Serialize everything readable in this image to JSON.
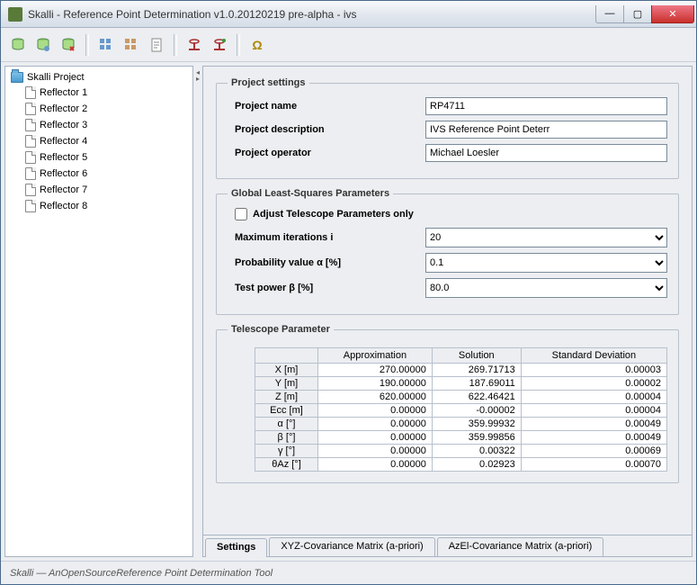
{
  "window": {
    "title": "Skalli - Reference Point Determination v1.0.20120219 pre-alpha - ivs"
  },
  "tree": {
    "root": "Skalli Project",
    "items": [
      "Reflector 1",
      "Reflector 2",
      "Reflector 3",
      "Reflector 4",
      "Reflector 5",
      "Reflector 6",
      "Reflector 7",
      "Reflector 8"
    ]
  },
  "project": {
    "legend": "Project settings",
    "name_label": "Project name",
    "name_value": "RP4711",
    "desc_label": "Project description",
    "desc_value": "IVS Reference Point Deterr",
    "op_label": "Project operator",
    "op_value": "Michael Loesler"
  },
  "gls": {
    "legend": "Global Least-Squares Parameters",
    "adjust_label": "Adjust Telescope Parameters only",
    "maxiter_label": "Maximum iterations i",
    "maxiter_value": "20",
    "prob_label": "Probability value α [%]",
    "prob_value": "0.1",
    "power_label": "Test power β [%]",
    "power_value": "80.0"
  },
  "tp": {
    "legend": "Telescope Parameter",
    "cols": [
      "Approximation",
      "Solution",
      "Standard Deviation"
    ],
    "rows": [
      {
        "name": "X [m]",
        "a": "270.00000",
        "s": "269.71713",
        "d": "0.00003"
      },
      {
        "name": "Y [m]",
        "a": "190.00000",
        "s": "187.69011",
        "d": "0.00002"
      },
      {
        "name": "Z [m]",
        "a": "620.00000",
        "s": "622.46421",
        "d": "0.00004"
      },
      {
        "name": "Ecc [m]",
        "a": "0.00000",
        "s": "-0.00002",
        "d": "0.00004"
      },
      {
        "name": "α [°]",
        "a": "0.00000",
        "s": "359.99932",
        "d": "0.00049"
      },
      {
        "name": "β [°]",
        "a": "0.00000",
        "s": "359.99856",
        "d": "0.00049"
      },
      {
        "name": "γ [°]",
        "a": "0.00000",
        "s": "0.00322",
        "d": "0.00069"
      },
      {
        "name": "θAz [°]",
        "a": "0.00000",
        "s": "0.02923",
        "d": "0.00070"
      }
    ]
  },
  "tabs": {
    "t0": "Settings",
    "t1": "XYZ-Covariance Matrix (a-priori)",
    "t2": "AzEl-Covariance Matrix (a-priori)"
  },
  "status": {
    "prefix": "Skalli — An ",
    "em": "OpenSource",
    "suffix": " Reference Point Determination Tool"
  }
}
